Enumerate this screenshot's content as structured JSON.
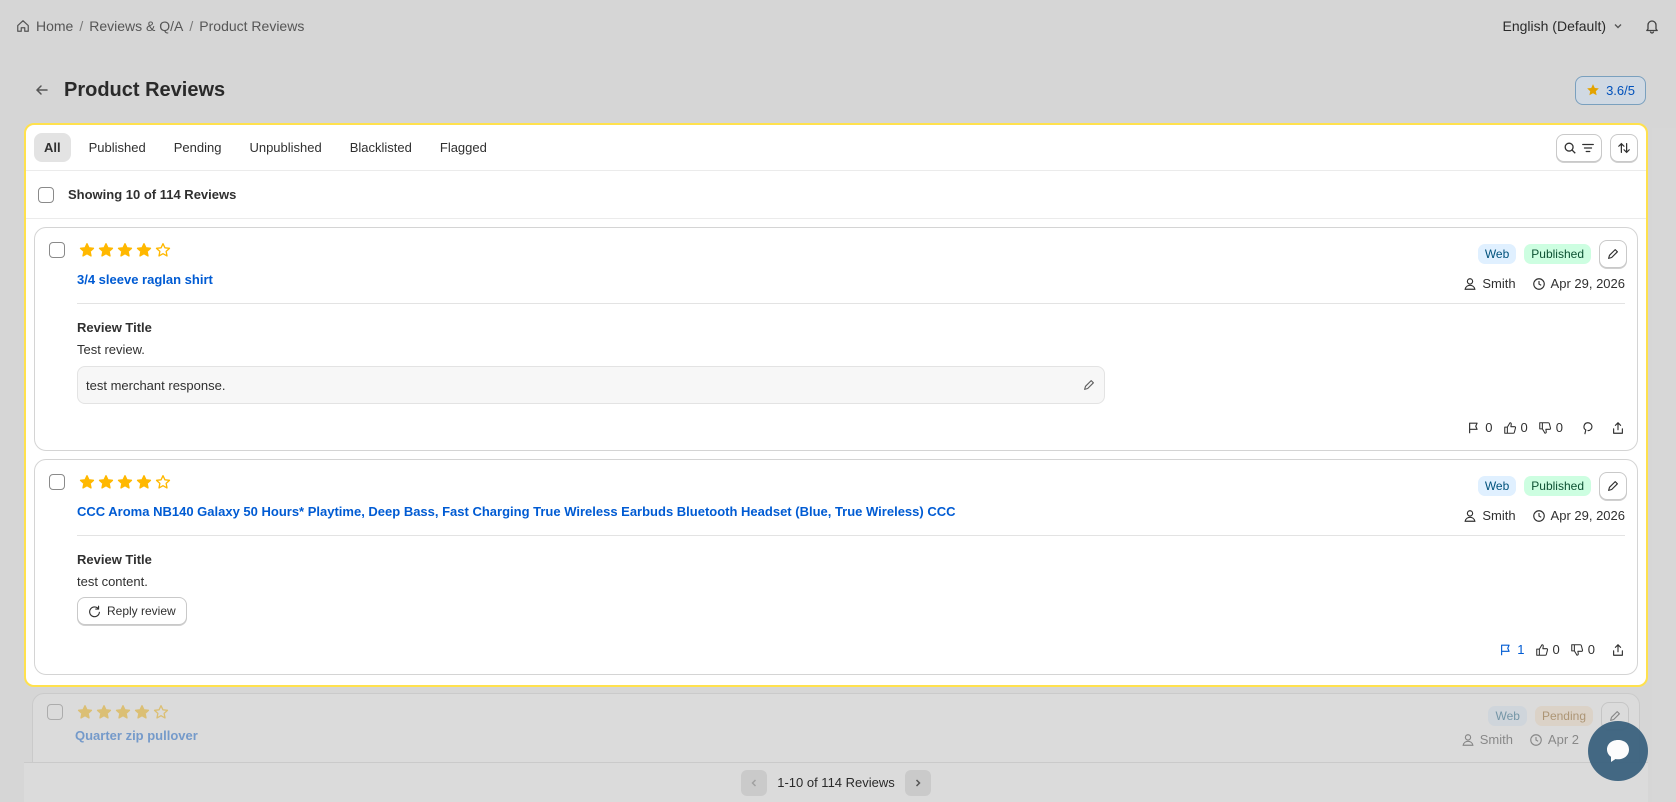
{
  "breadcrumb": {
    "home": "Home",
    "section": "Reviews & Q/A",
    "current": "Product Reviews"
  },
  "topbar": {
    "language": "English (Default)"
  },
  "page": {
    "title": "Product Reviews",
    "rating": "3.6/5"
  },
  "tabs": [
    "All",
    "Published",
    "Pending",
    "Unpublished",
    "Blacklisted",
    "Flagged"
  ],
  "active_tab": "All",
  "list": {
    "showing": "Showing 10 of 114 Reviews"
  },
  "reviews": [
    {
      "rating": 4,
      "product": "3/4 sleeve raglan shirt",
      "source": "Web",
      "status": "Published",
      "author": "Smith",
      "date": "Apr 29, 2026",
      "title": "Review Title",
      "content": "Test review.",
      "merchant_response": "test merchant response.",
      "flags": "0",
      "likes": "0",
      "dislikes": "0"
    },
    {
      "rating": 4,
      "product": "CCC Aroma NB140 Galaxy 50 Hours* Playtime, Deep Bass, Fast Charging True Wireless Earbuds Bluetooth Headset (Blue, True Wireless) CCC",
      "source": "Web",
      "status": "Published",
      "author": "Smith",
      "date": "Apr 29, 2026",
      "title": "Review Title",
      "content": "test content.",
      "reply_label": "Reply review",
      "flags": "1",
      "likes": "0",
      "dislikes": "0"
    },
    {
      "rating": 4,
      "product": "Quarter zip pullover",
      "source": "Web",
      "status": "Pending",
      "author": "Smith",
      "date": "Apr 2"
    }
  ],
  "pagination": {
    "label": "1-10 of 114 Reviews"
  },
  "colors": {
    "star": "#ffb800",
    "link": "#005bd3",
    "highlight_border": "#ffe14d"
  }
}
